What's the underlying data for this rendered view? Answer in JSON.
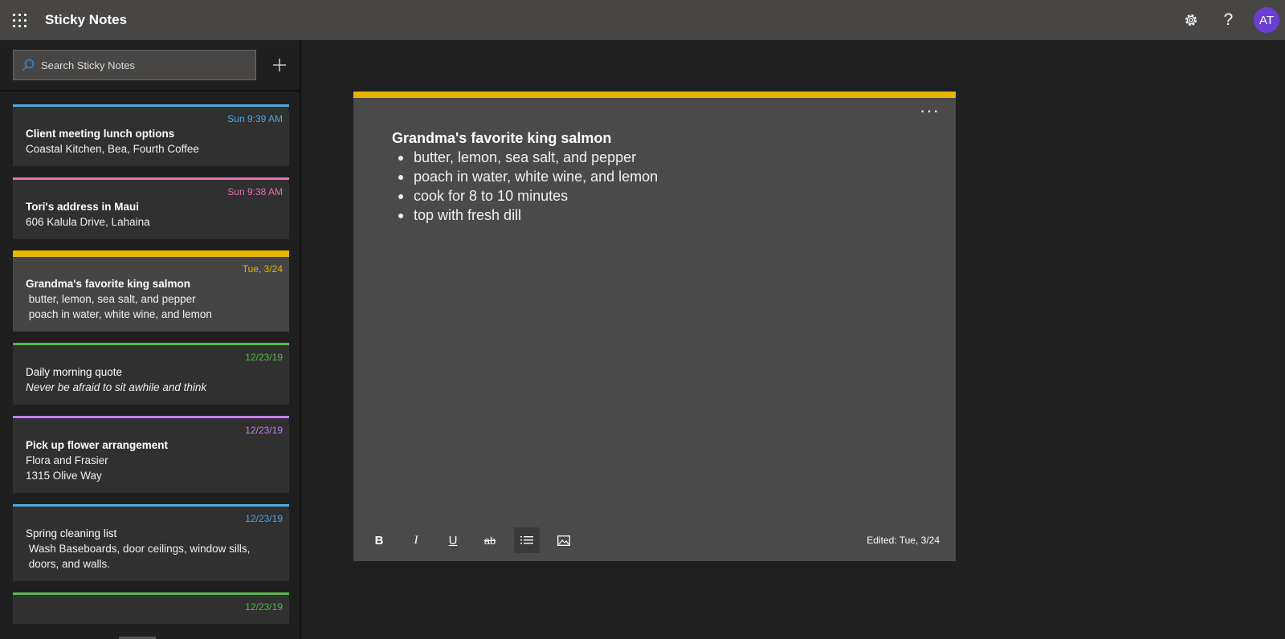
{
  "app": {
    "title": "Sticky Notes",
    "avatar_initials": "AT",
    "icons": {
      "menu": "waffle-icon",
      "settings": "gear-icon",
      "help": "help-icon"
    }
  },
  "sidebar": {
    "search_placeholder": "Search Sticky Notes",
    "add_icon": "plus-icon",
    "notes": [
      {
        "date": "Sun 9:39 AM",
        "color": "#4aa9dd",
        "title": "Client meeting lunch options",
        "title_bold": true,
        "lines": [
          "Coastal Kitchen, Bea, Fourth Coffee"
        ],
        "italic": false,
        "selected": false
      },
      {
        "date": "Sun 9:38 AM",
        "color": "#e96fb3",
        "title": "Tori's address in Maui",
        "title_bold": true,
        "lines": [
          "606 Kalula Drive, Lahaina"
        ],
        "italic": false,
        "selected": false
      },
      {
        "date": "Tue, 3/24",
        "color": "#e8b600",
        "title": "Grandma's favorite king salmon",
        "title_bold": true,
        "lines": [
          " butter, lemon, sea salt, and pepper",
          " poach in water, white wine, and lemon"
        ],
        "italic": false,
        "selected": true
      },
      {
        "date": "12/23/19",
        "color": "#5ab64f",
        "title": "Daily morning quote",
        "title_bold": false,
        "lines": [
          "Never be afraid to sit awhile and think"
        ],
        "italic": true,
        "selected": false
      },
      {
        "date": "12/23/19",
        "color": "#c57ff0",
        "title": "Pick up flower arrangement",
        "title_bold": true,
        "lines": [
          "Flora and Frasier",
          "1315 Olive Way"
        ],
        "italic": false,
        "selected": false
      },
      {
        "date": "12/23/19",
        "color": "#4aa9dd",
        "title": "Spring cleaning list",
        "title_bold": false,
        "lines": [
          " Wash Baseboards, door ceilings, window sills,",
          " doors, and walls."
        ],
        "italic": false,
        "selected": false
      },
      {
        "date": "12/23/19",
        "color": "#5ab64f",
        "title": "",
        "title_bold": false,
        "lines": [],
        "italic": false,
        "selected": false
      }
    ]
  },
  "editor": {
    "accent": "#e8b600",
    "more_label": "···",
    "title": "Grandma's favorite king salmon",
    "items": [
      "butter, lemon, sea salt, and pepper",
      "poach in water, white wine, and lemon",
      "cook for 8 to 10 minutes",
      "top with fresh dill"
    ],
    "toolbar": {
      "bold": "B",
      "italic": "I",
      "underline": "U",
      "strikethrough": "ab"
    },
    "edited": "Edited: Tue, 3/24"
  }
}
